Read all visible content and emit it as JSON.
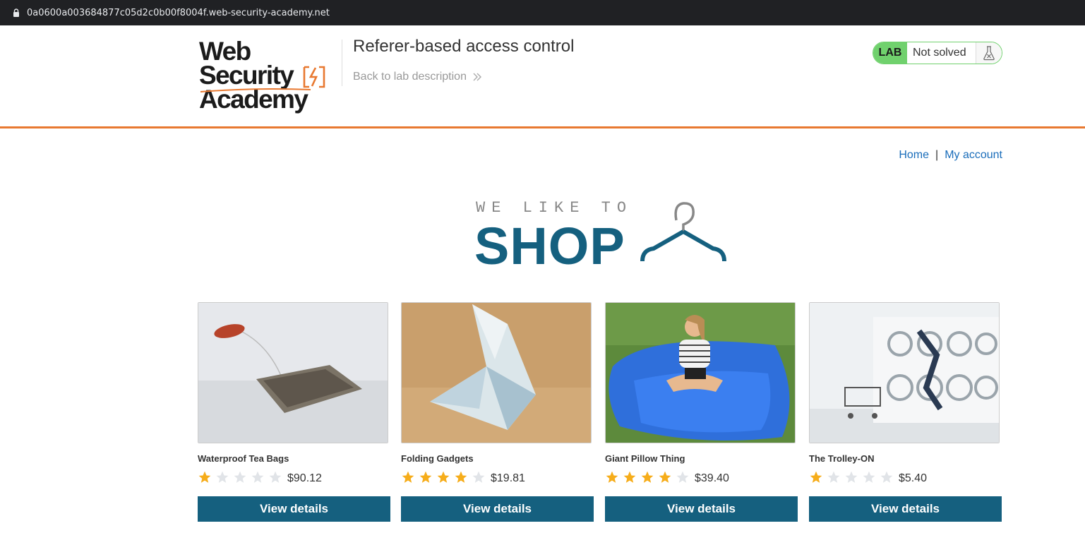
{
  "browser": {
    "url": "0a0600a003684877c05d2c0b00f8004f.web-security-academy.net"
  },
  "lab_header": {
    "logo_line1": "Web Security",
    "logo_line2": "Academy",
    "title": "Referer-based access control",
    "back_link": "Back to lab description",
    "status_tag": "LAB",
    "status_text": "Not solved",
    "colors": {
      "accent": "#e87931",
      "status_green": "#70d16d"
    }
  },
  "nav": {
    "home": "Home",
    "separator": "|",
    "account": "My account"
  },
  "banner": {
    "tagline": "WE LIKE TO",
    "shop": "SHOP",
    "color": "#15607f"
  },
  "products": [
    {
      "name": "Waterproof Tea Bags",
      "rating": 1,
      "price": "$90.12",
      "button": "View details",
      "image": "tea-bag-image"
    },
    {
      "name": "Folding Gadgets",
      "rating": 4,
      "price": "$19.81",
      "button": "View details",
      "image": "origami-bird-image"
    },
    {
      "name": "Giant Pillow Thing",
      "rating": 4,
      "price": "$39.40",
      "button": "View details",
      "image": "girl-on-blue-pillow-image"
    },
    {
      "name": "The Trolley-ON",
      "rating": 1,
      "price": "$5.40",
      "button": "View details",
      "image": "laundromat-image"
    }
  ]
}
